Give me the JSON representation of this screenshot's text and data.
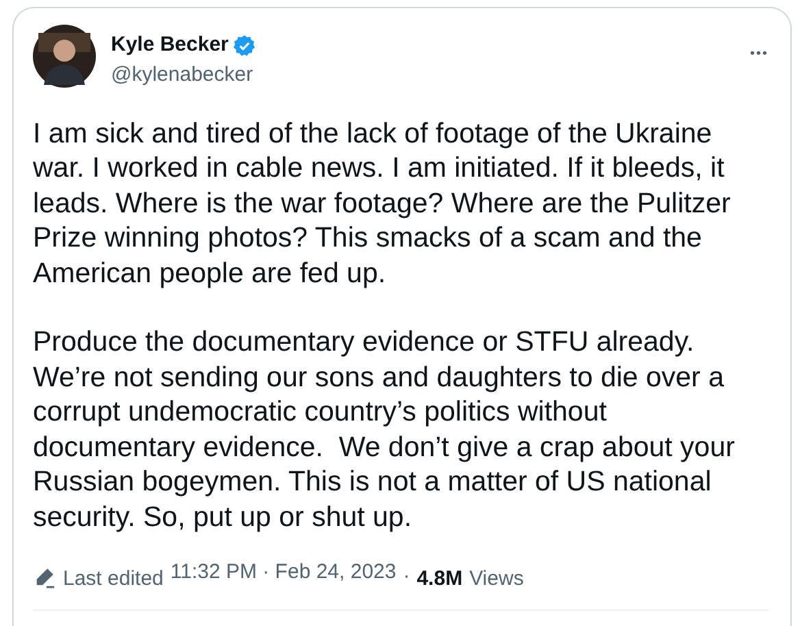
{
  "author": {
    "name": "Kyle Becker",
    "verified": true,
    "handle": "@kylenabecker"
  },
  "more_menu": "•••",
  "body": [
    "I am sick and tired of the lack of footage of the Ukraine war. I worked in cable news. I am initiated. If it bleeds, it leads. Where is the war footage? Where are the Pulitzer Prize winning photos? This smacks of a scam and the American people are fed up.",
    "Produce the documentary evidence or STFU already. We’re not sending our sons and daughters to die over a corrupt undemocratic country’s politics without documentary evidence.  We don’t give a crap about your Russian bogeymen. This is not a matter of US national security. So, put up or shut up."
  ],
  "footer": {
    "edited_label": "Last edited",
    "timestamp": "11:32 PM · Feb 24, 2023",
    "separator": "·",
    "views_count": "4.8M",
    "views_label": "Views"
  }
}
